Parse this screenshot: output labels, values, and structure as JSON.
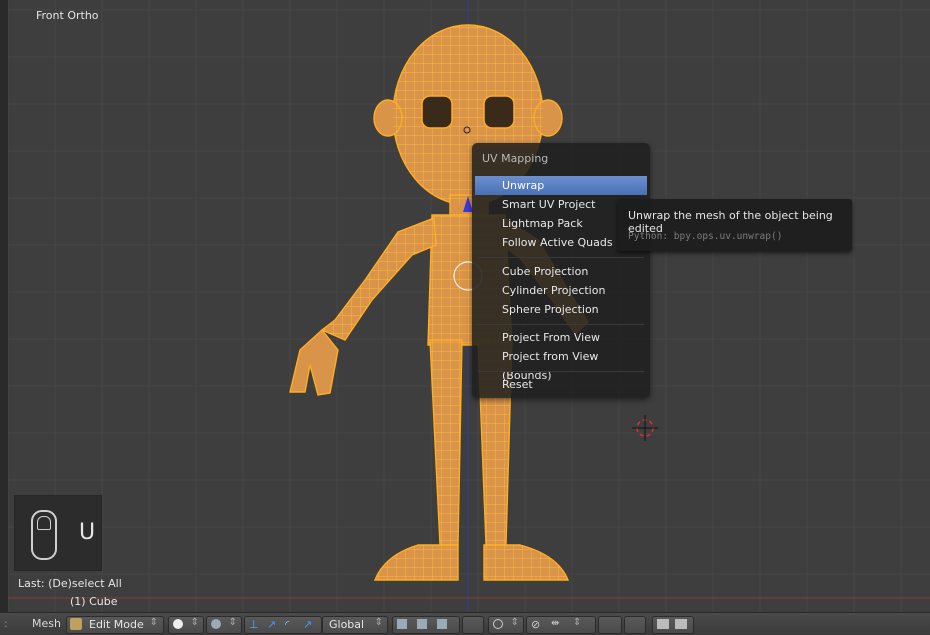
{
  "viewport": {
    "view_name": "Front Ortho",
    "last_operator": "Last: (De)select All",
    "object_info": "(1) Cube",
    "key_display": "U"
  },
  "uv_menu": {
    "title": "UV Mapping",
    "items": [
      {
        "label": "Unwrap",
        "active": true
      },
      {
        "label": "Smart UV Project"
      },
      {
        "label": "Lightmap Pack"
      },
      {
        "label": "Follow Active Quads"
      },
      {
        "label": "Cube Projection"
      },
      {
        "label": "Cylinder Projection"
      },
      {
        "label": "Sphere Projection"
      },
      {
        "label": "Project From View"
      },
      {
        "label": "Project from View (Bounds)"
      },
      {
        "label": "Reset"
      }
    ]
  },
  "tooltip": {
    "title": "Unwrap the mesh of the object being edited",
    "python": "Python: bpy.ops.uv.unwrap()"
  },
  "header": {
    "mesh_label": "Mesh",
    "mode_label": "Edit Mode",
    "orientation_label": "Global"
  },
  "colors": {
    "mesh_fill": "#e8a04a",
    "mesh_wire": "#ffb319",
    "menu_highlight": "#5a7fc3",
    "background": "#3e3e3e"
  }
}
